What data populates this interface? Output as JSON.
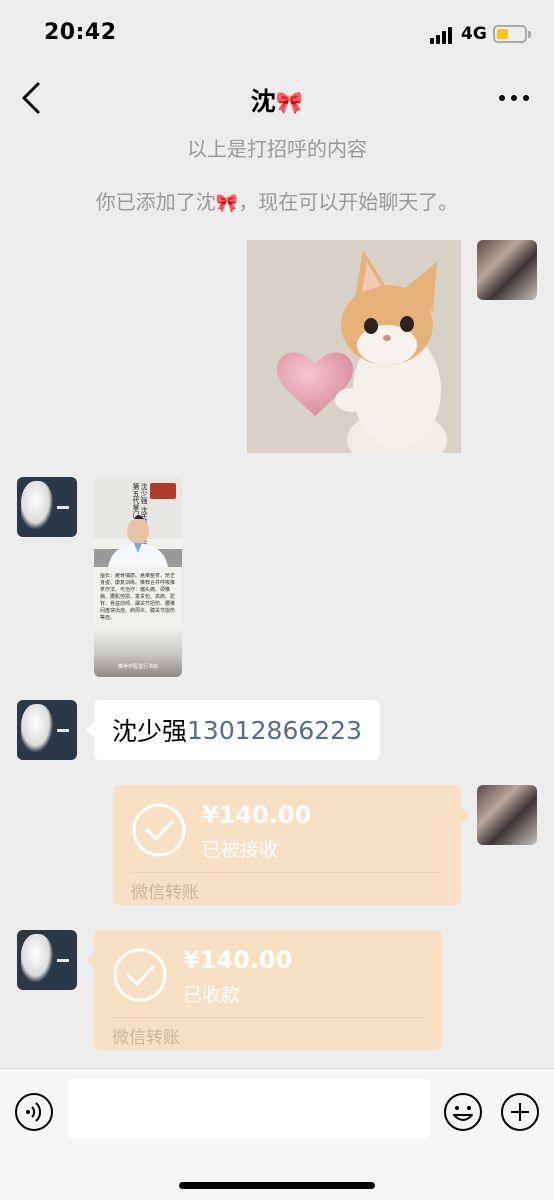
{
  "status_bar": {
    "time": "20:42",
    "network": "4G"
  },
  "nav": {
    "title": "沈",
    "title_emoji": "🎀"
  },
  "system_notes": {
    "greeting_end": "以上是打招呼的内容",
    "added_prefix": "你已添加了沈",
    "added_emoji": "🎀",
    "added_suffix": "，现在可以开始聊天了。"
  },
  "messages": {
    "poster": {
      "name_lines": [
        "沈少强",
        "沈氏推骨复位术",
        "第五代掌门人"
      ],
      "desc": "擅长：腰骨抽筋、悬推整脊、矫正身姿、康复训练。推荐合并呼吸推拿疗法。可治疗：偏头痛、颈椎病、腰肌劳损、富贵包、高肩、驼背、骨盆前倾、踝关节扭伤、腰椎间盘突出症、肩周炎、膝关节损伤等症。",
      "footer": "推骨中医堂行书城"
    },
    "text_bubble": {
      "name": "沈少强",
      "phone": "13012866223"
    },
    "transfer_sent": {
      "amount": "¥140.00",
      "status": "已被接收",
      "footer": "微信转账"
    },
    "transfer_received": {
      "amount": "¥140.00",
      "status": "已收款",
      "footer": "微信转账"
    }
  },
  "input_bar": {
    "placeholder": ""
  },
  "colors": {
    "background": "#ededed",
    "transfer_card": "#f8e0c4",
    "link_blue": "#576b95",
    "system_text": "#9a9a9a"
  },
  "icons": {
    "back": "chevron-left-icon",
    "more": "ellipsis-icon",
    "voice": "voice-icon",
    "emoji": "emoji-icon",
    "plus": "plus-icon",
    "check": "check-circle-icon"
  }
}
